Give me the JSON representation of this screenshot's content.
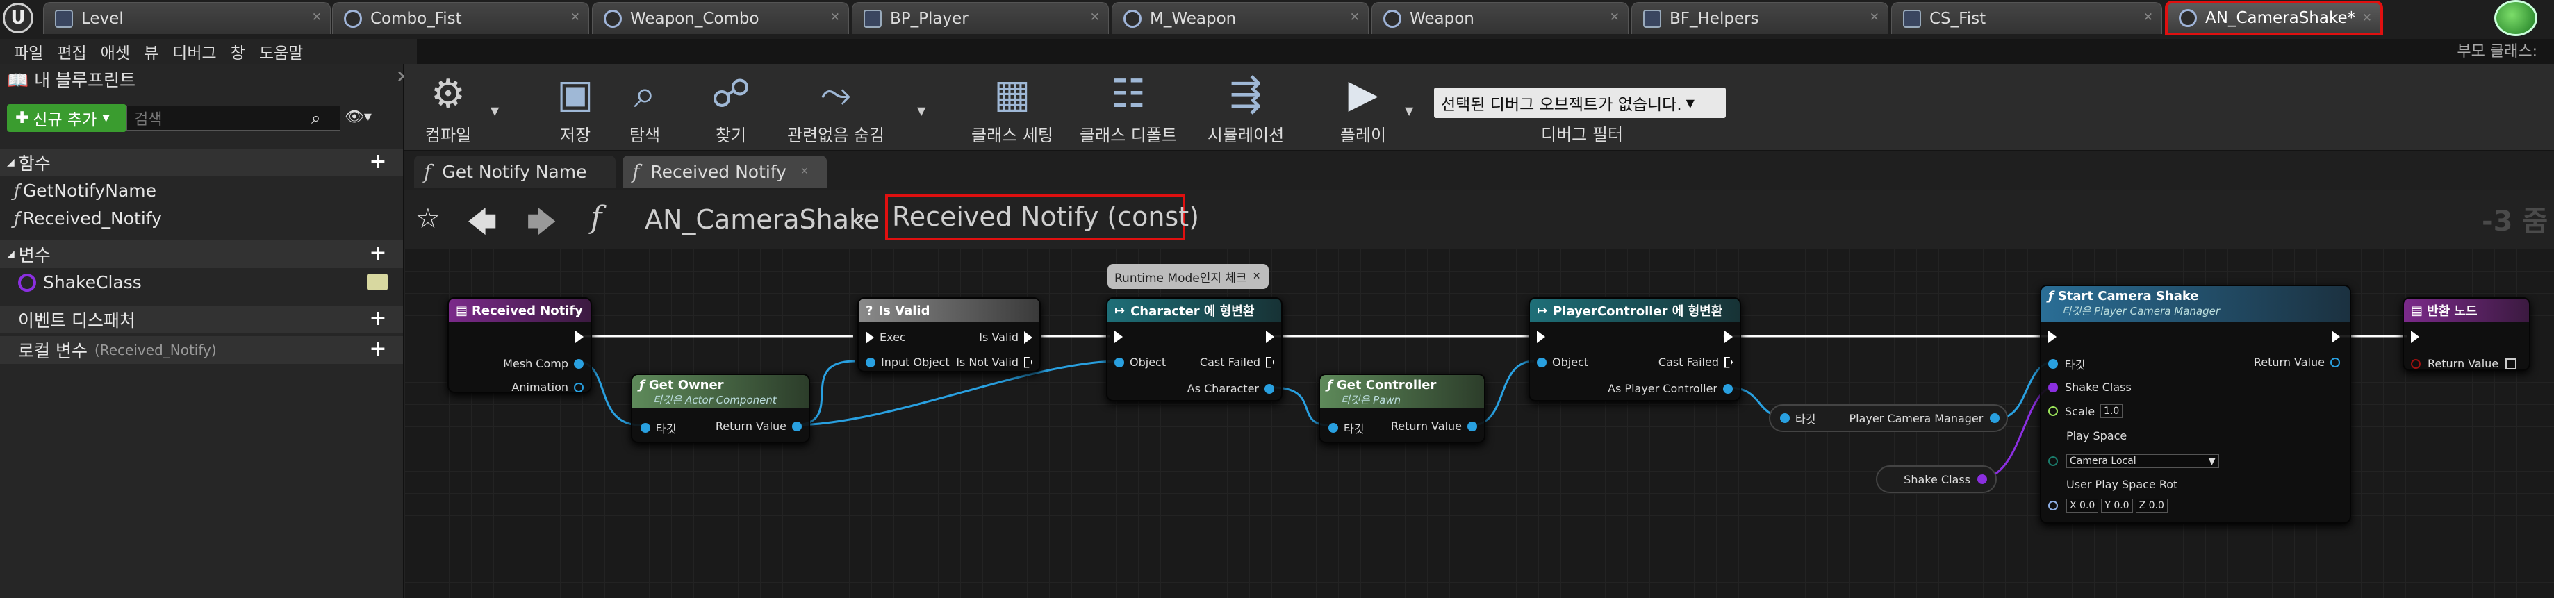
{
  "tabs": [
    {
      "label": "Level",
      "icon": "level-icon"
    },
    {
      "label": "Combo_Fist",
      "icon": "blueprint-icon"
    },
    {
      "label": "Weapon_Combo",
      "icon": "blueprint-icon"
    },
    {
      "label": "BP_Player",
      "icon": "blueprint-icon"
    },
    {
      "label": "M_Weapon",
      "icon": "material-icon"
    },
    {
      "label": "Weapon",
      "icon": "blueprint-icon"
    },
    {
      "label": "BF_Helpers",
      "icon": "blueprint-icon"
    },
    {
      "label": "CS_Fist",
      "icon": "blueprint-icon"
    },
    {
      "label": "AN_CameraShake*",
      "icon": "blueprint-icon"
    }
  ],
  "menu": [
    "파일",
    "편집",
    "애셋",
    "뷰",
    "디버그",
    "창",
    "도움말"
  ],
  "parent_class": "부모 클래스:",
  "left_panel": {
    "title": "내 블루프린트",
    "add_new": "신규 추가",
    "search_placeholder": "검색",
    "functions_header": "함수",
    "functions": [
      "GetNotifyName",
      "Received_Notify"
    ],
    "variables_header": "변수",
    "variables": [
      "ShakeClass"
    ],
    "dispatchers_header": "이벤트 디스패처",
    "local_vars_header": "로컬 변수",
    "local_vars_scope": "(Received_Notify)"
  },
  "toolbar": {
    "compile": "컴파일",
    "save": "저장",
    "browse": "탐색",
    "find": "찾기",
    "hide_unrelated": "관련없음 숨김",
    "class_settings": "클래스 세팅",
    "class_defaults": "클래스 디폴트",
    "simulation": "시뮬레이션",
    "play": "플레이",
    "debug_object": "선택된 디버그 오브젝트가 없습니다.",
    "debug_filter": "디버그 필터"
  },
  "graph_tabs": [
    "Get Notify Name",
    "Received Notify"
  ],
  "breadcrumb": {
    "class": "AN_CameraShake",
    "graph": "Received Notify (const)",
    "zoom": "-3 줌"
  },
  "nodes": {
    "received_notify": {
      "title": "Received Notify",
      "pins": [
        "Mesh Comp",
        "Animation"
      ]
    },
    "get_owner": {
      "title": "Get Owner",
      "subtitle": "타깃은 Actor Component",
      "target": "타깃",
      "ret": "Return Value"
    },
    "is_valid": {
      "title": "Is Valid",
      "exec": "Exec",
      "input": "Input Object",
      "valid": "Is Valid",
      "not_valid": "Is Not Valid"
    },
    "comment": "Runtime Mode인지 체크",
    "cast_char": {
      "title": "Character 에 형변환",
      "object": "Object",
      "failed": "Cast Failed",
      "as": "As Character"
    },
    "get_controller": {
      "title": "Get Controller",
      "subtitle": "타깃은 Pawn",
      "target": "타깃",
      "ret": "Return Value"
    },
    "cast_pc": {
      "title": "PlayerController 에 형변환",
      "object": "Object",
      "failed": "Cast Failed",
      "as": "As Player Controller"
    },
    "pcm_node": {
      "target": "타깃",
      "label": "Player Camera Manager"
    },
    "shake_var": "Shake Class",
    "start_shake": {
      "title": "Start Camera Shake",
      "subtitle": "타깃은 Player Camera Manager",
      "target": "타깃",
      "shake": "Shake Class",
      "scale": "Scale",
      "scale_val": "1.0",
      "play_space": "Play Space",
      "play_space_val": "Camera Local",
      "rot": "User Play Space Rot",
      "rx": "0.0",
      "ry": "0.0",
      "rz": "0.0",
      "ret": "Return Value"
    },
    "return_node": {
      "title": "반환 노드",
      "ret": "Return Value"
    }
  }
}
